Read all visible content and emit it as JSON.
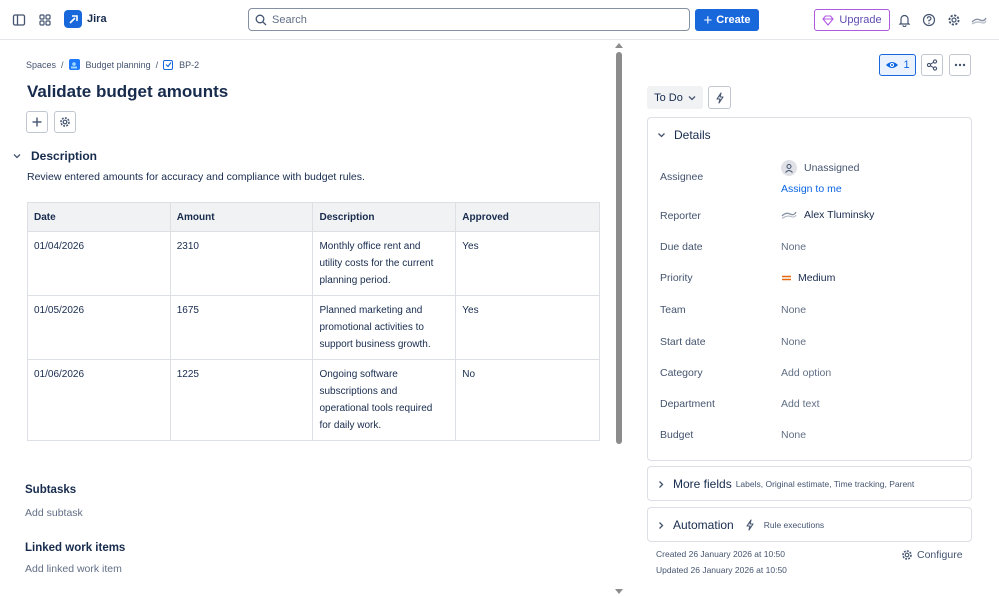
{
  "topbar": {
    "app_name": "Jira",
    "search_placeholder": "Search",
    "create_label": "Create",
    "upgrade_label": "Upgrade",
    "brand_color": "#1868db"
  },
  "breadcrumb": {
    "items": [
      "Spaces",
      "Budget planning",
      "BP-2"
    ]
  },
  "issue": {
    "title": "Validate budget amounts",
    "description_heading": "Description",
    "description_text": "Review entered amounts for accuracy and compliance with budget rules."
  },
  "table": {
    "headers": [
      "Date",
      "Amount",
      "Description",
      "Approved"
    ],
    "rows": [
      {
        "date": "01/04/2026",
        "amount": "2310",
        "description": [
          "Monthly office rent and",
          "utility costs for the current",
          "planning period."
        ],
        "approved": "Yes"
      },
      {
        "date": "01/05/2026",
        "amount": "1675",
        "description": [
          "Planned marketing and",
          "promotional activities to",
          "support business growth."
        ],
        "approved": "Yes"
      },
      {
        "date": "01/06/2026",
        "amount": "1225",
        "description": [
          "Ongoing software",
          "subscriptions and",
          "operational tools required",
          "for daily work."
        ],
        "approved": "No"
      }
    ]
  },
  "subtasks": {
    "title": "Subtasks",
    "add_label": "Add subtask"
  },
  "linked": {
    "title": "Linked work items",
    "add_label": "Add linked work item"
  },
  "sidebar": {
    "watch_count": "1",
    "status": "To Do",
    "details_title": "Details",
    "fields": {
      "assignee_label": "Assignee",
      "assignee_value": "Unassigned",
      "assign_to_me": "Assign to me",
      "reporter_label": "Reporter",
      "reporter_value": "Alex Tluminsky",
      "due_date_label": "Due date",
      "due_date_value": "None",
      "priority_label": "Priority",
      "priority_value": "Medium",
      "team_label": "Team",
      "team_value": "None",
      "start_date_label": "Start date",
      "start_date_value": "None",
      "category_label": "Category",
      "category_value": "Add option",
      "department_label": "Department",
      "department_value": "Add text",
      "budget_label": "Budget",
      "budget_value": "None"
    },
    "more_fields_title": "More fields",
    "more_fields_sub": "Labels, Original estimate, Time tracking, Parent",
    "automation_title": "Automation",
    "automation_sub": "Rule executions",
    "created": "Created 26 January 2026 at 10:50",
    "updated": "Updated 26 January 2026 at 10:50",
    "configure_label": "Configure"
  }
}
